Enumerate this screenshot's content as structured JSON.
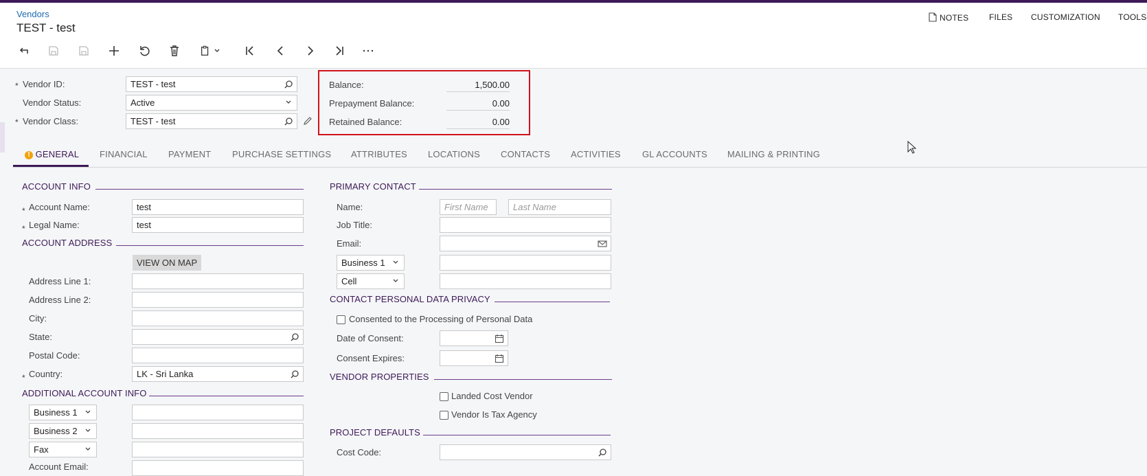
{
  "breadcrumb": "Vendors",
  "title": "TEST - test",
  "topmenu": {
    "notes": "NOTES",
    "files": "FILES",
    "customization": "CUSTOMIZATION",
    "tools": "TOOLS"
  },
  "summary": {
    "vendor_id_label": "Vendor ID:",
    "vendor_id": "TEST - test",
    "vendor_status_label": "Vendor Status:",
    "vendor_status": "Active",
    "vendor_class_label": "Vendor Class:",
    "vendor_class": "TEST - test",
    "balance_label": "Balance:",
    "balance": "1,500.00",
    "prepayment_label": "Prepayment Balance:",
    "prepayment": "0.00",
    "retained_label": "Retained Balance:",
    "retained": "0.00"
  },
  "tabs": [
    "GENERAL",
    "FINANCIAL",
    "PAYMENT",
    "PURCHASE SETTINGS",
    "ATTRIBUTES",
    "LOCATIONS",
    "CONTACTS",
    "ACTIVITIES",
    "GL ACCOUNTS",
    "MAILING & PRINTING"
  ],
  "account_info": {
    "section": "ACCOUNT INFO",
    "account_name_label": "Account Name:",
    "account_name": "test",
    "legal_name_label": "Legal Name:",
    "legal_name": "test"
  },
  "account_address": {
    "section": "ACCOUNT ADDRESS",
    "view_on_map": "VIEW ON MAP",
    "line1_label": "Address Line 1:",
    "line2_label": "Address Line 2:",
    "city_label": "City:",
    "state_label": "State:",
    "postal_label": "Postal Code:",
    "country_label": "Country:",
    "country": "LK - Sri Lanka"
  },
  "additional_info": {
    "section": "ADDITIONAL ACCOUNT INFO",
    "phone1_type": "Business 1",
    "phone2_type": "Business 2",
    "fax_type": "Fax",
    "email_label": "Account Email:"
  },
  "primary_contact": {
    "section": "PRIMARY CONTACT",
    "name_label": "Name:",
    "first_name_placeholder": "First Name",
    "last_name_placeholder": "Last Name",
    "job_title_label": "Job Title:",
    "email_label": "Email:",
    "phone1_type": "Business 1",
    "phone2_type": "Cell"
  },
  "privacy": {
    "section": "CONTACT PERSONAL DATA PRIVACY",
    "consent_label": "Consented to the Processing of Personal Data",
    "date_of_consent_label": "Date of Consent:",
    "consent_expires_label": "Consent Expires:"
  },
  "vendor_properties": {
    "section": "VENDOR PROPERTIES",
    "landed_cost": "Landed Cost Vendor",
    "tax_agency": "Vendor Is Tax Agency"
  },
  "project_defaults": {
    "section": "PROJECT DEFAULTS",
    "cost_code_label": "Cost Code:"
  },
  "colors": {
    "accent": "#3d1a57",
    "link": "#1d6ab1",
    "highlight_box": "#d0121b"
  }
}
